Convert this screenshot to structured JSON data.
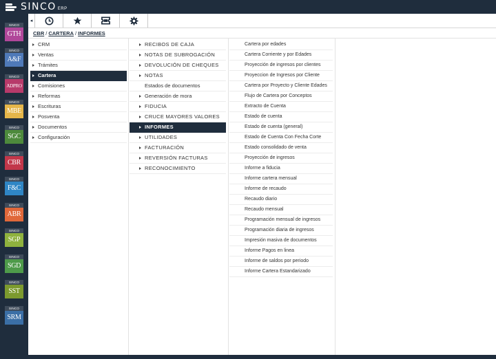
{
  "app": {
    "name": "SINCO",
    "sub": "ERP"
  },
  "toolbar": {
    "collapse_glyph": "◂",
    "buttons": [
      "clock-icon",
      "star-icon",
      "ticket-icon",
      "gear-icon"
    ]
  },
  "modules": [
    {
      "top": "SINCO",
      "label": "GTH",
      "color": "#b0479a"
    },
    {
      "top": "SINCO",
      "label": "A&F",
      "color": "#4f7ab9"
    },
    {
      "top": "SINCO",
      "label": "ADPRO",
      "color": "#b73a6a"
    },
    {
      "top": "SINCO",
      "label": "MBE",
      "color": "#e5b64a"
    },
    {
      "top": "SINCO",
      "label": "SGC",
      "color": "#4d8a3c"
    },
    {
      "top": "SINCO",
      "label": "CBR",
      "color": "#c2374a"
    },
    {
      "top": "SINCO",
      "label": "F&C",
      "color": "#2f86c5"
    },
    {
      "top": "SINCO",
      "label": "ABR",
      "color": "#e0683a"
    },
    {
      "top": "SINCO",
      "label": "SGP",
      "color": "#8fb23e"
    },
    {
      "top": "SINCO",
      "label": "SGD",
      "color": "#4e9a4a"
    },
    {
      "top": "SINCO",
      "label": "SST",
      "color": "#7c9a2e"
    },
    {
      "top": "SINCO",
      "label": "SRM",
      "color": "#3b6fa6"
    }
  ],
  "breadcrumb": [
    "CBR",
    "CARTERA",
    "INFORMES"
  ],
  "breadcrumb_sep": "/",
  "col1": [
    {
      "label": "CRM",
      "tri": true
    },
    {
      "label": "Ventas",
      "tri": true
    },
    {
      "label": "Trámites",
      "tri": true
    },
    {
      "label": "Cartera",
      "tri": true,
      "selected": true
    },
    {
      "label": "Comisiones",
      "tri": true
    },
    {
      "label": "Reformas",
      "tri": true
    },
    {
      "label": "Escrituras",
      "tri": true
    },
    {
      "label": "Posventa",
      "tri": true
    },
    {
      "label": "Documentos",
      "tri": true
    },
    {
      "label": "Configuración",
      "tri": true
    }
  ],
  "col2": [
    {
      "label": "RECIBOS DE CAJA",
      "tri": true
    },
    {
      "label": "NOTAS DE SUBROGACIÓN",
      "tri": true
    },
    {
      "label": "DEVOLUCIÓN DE CHEQUES",
      "tri": true
    },
    {
      "label": "NOTAS",
      "tri": true
    },
    {
      "label": "Estados de documentos",
      "tri": false
    },
    {
      "label": "Generación de mora",
      "tri": true
    },
    {
      "label": "FIDUCIA",
      "tri": true
    },
    {
      "label": "CRUCE MAYORES VALORES",
      "tri": true
    },
    {
      "label": "INFORMES",
      "tri": true,
      "selected": true
    },
    {
      "label": "UTILIDADES",
      "tri": true
    },
    {
      "label": "FACTURACIÓN",
      "tri": true
    },
    {
      "label": "REVERSIÓN FACTURAS",
      "tri": true
    },
    {
      "label": "RECONOCIMIENTO",
      "tri": true
    }
  ],
  "col3": [
    "Cartera por edades",
    "Cartera Corriente y por Edades",
    "Proyección de ingresos por clientes",
    "Proyeccion de Ingresos por Cliente",
    "Cartera por Proyecto y Cliente Edades",
    "Flujo de Cartera por Conceptos",
    "Extracto de Cuenta",
    "Estado de cuenta",
    "Estado de cuenta (general)",
    "Estado de Cuenta Con Fecha Corte",
    "Estado consolidado de venta",
    "Proyección de ingresos",
    "Informe a fiducia",
    "Informe cartera mensual",
    "Informe de recaudo",
    "Recaudo diario",
    "Recaudo mensual",
    "Programación mensual de ingresos",
    "Programación diaria de ingresos",
    "Impresión masiva de documentos",
    "Informe Pagos en linea",
    "Informe de saldos por periodo",
    "Informe Cartera Estandarizado"
  ]
}
